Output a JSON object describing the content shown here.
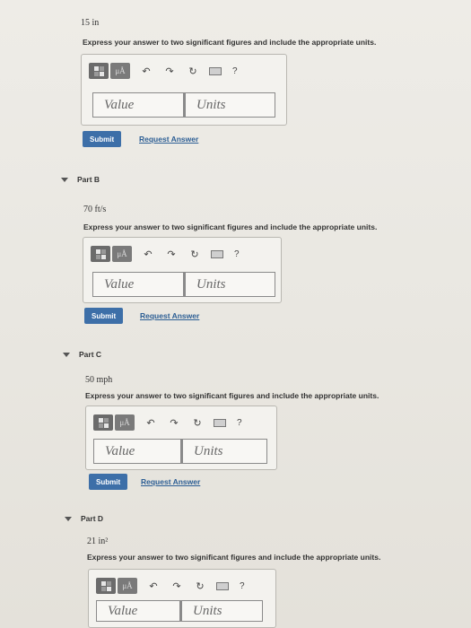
{
  "partA": {
    "given": "15 in",
    "instruction": "Express your answer to two significant figures and include the appropriate units.",
    "value_placeholder": "Value",
    "units_placeholder": "Units",
    "submit": "Submit",
    "request": "Request Answer"
  },
  "partB": {
    "title": "Part B",
    "given": "70 ft/s",
    "instruction": "Express your answer to two significant figures and include the appropriate units.",
    "value_placeholder": "Value",
    "units_placeholder": "Units",
    "submit": "Submit",
    "request": "Request Answer"
  },
  "partC": {
    "title": "Part C",
    "given": "50 mph",
    "instruction": "Express your answer to two significant figures and include the appropriate units.",
    "value_placeholder": "Value",
    "units_placeholder": "Units",
    "submit": "Submit",
    "request": "Request Answer"
  },
  "partD": {
    "title": "Part D",
    "given": "21 in²",
    "instruction": "Express your answer to two significant figures and include the appropriate units.",
    "value_placeholder": "Value",
    "units_placeholder": "Units"
  },
  "toolbar": {
    "mu_label": "μÅ",
    "undo_icon": "↶",
    "redo_icon": "↷",
    "reset_icon": "↻",
    "help": "?"
  }
}
